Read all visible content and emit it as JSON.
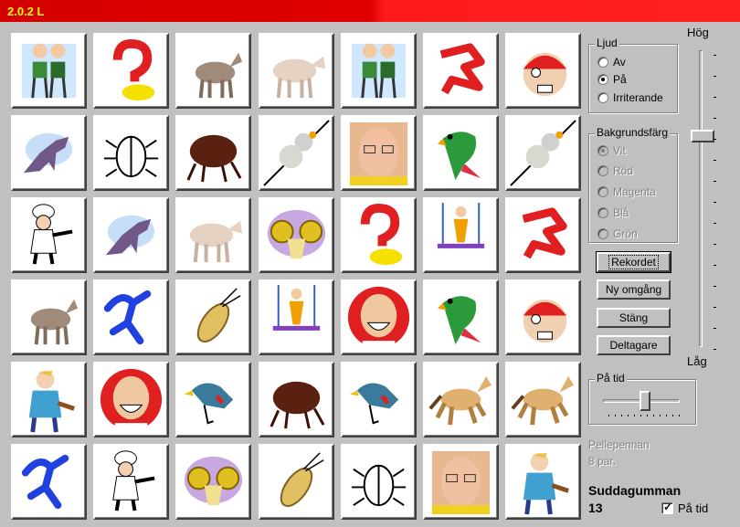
{
  "window": {
    "title": "2.0.2 L"
  },
  "cards": [
    [
      "boys",
      "question",
      "donkey",
      "cow",
      "boys",
      "red-runner",
      "pirate"
    ],
    [
      "dinosaur",
      "beetle",
      "flea",
      "snowman",
      "face",
      "parrot",
      "snowman"
    ],
    [
      "chef",
      "dinosaur",
      "cow",
      "ram",
      "question",
      "trapeze",
      "red-runner"
    ],
    [
      "donkey",
      "blue-runner",
      "cockroach",
      "trapeze",
      "laughing-man",
      "parrot",
      "pirate"
    ],
    [
      "carpenter",
      "laughing-man",
      "finch",
      "flea",
      "finch",
      "horse",
      "horse"
    ],
    [
      "blue-runner",
      "chef",
      "ram",
      "cockroach",
      "beetle",
      "face",
      "carpenter"
    ]
  ],
  "sound": {
    "label": "Ljud",
    "options": [
      "Av",
      "På",
      "Irriterande"
    ],
    "selected": "På"
  },
  "background": {
    "label": "Bakgrundsfärg",
    "options": [
      "Vit",
      "Röd",
      "Magenta",
      "Blå",
      "Grön"
    ],
    "selected": "Vit",
    "enabled": false
  },
  "buttons": {
    "records": "Rekordet",
    "new_round": "Ny omgång",
    "close": "Stäng",
    "players": "Deltagare"
  },
  "volume": {
    "high_label": "Hög",
    "low_label": "Låg",
    "level": 0.29
  },
  "timer": {
    "label": "På tid",
    "level": 0.55
  },
  "opponent": {
    "name": "Pellepennan",
    "pairs": "8 par."
  },
  "player": {
    "name": "Suddagumman",
    "score": "13",
    "timed_label": "På tid",
    "timed": true
  },
  "colors": {
    "titlebar": "#d40000",
    "title_text": "#ffff00",
    "face": "#c0c0c0"
  }
}
